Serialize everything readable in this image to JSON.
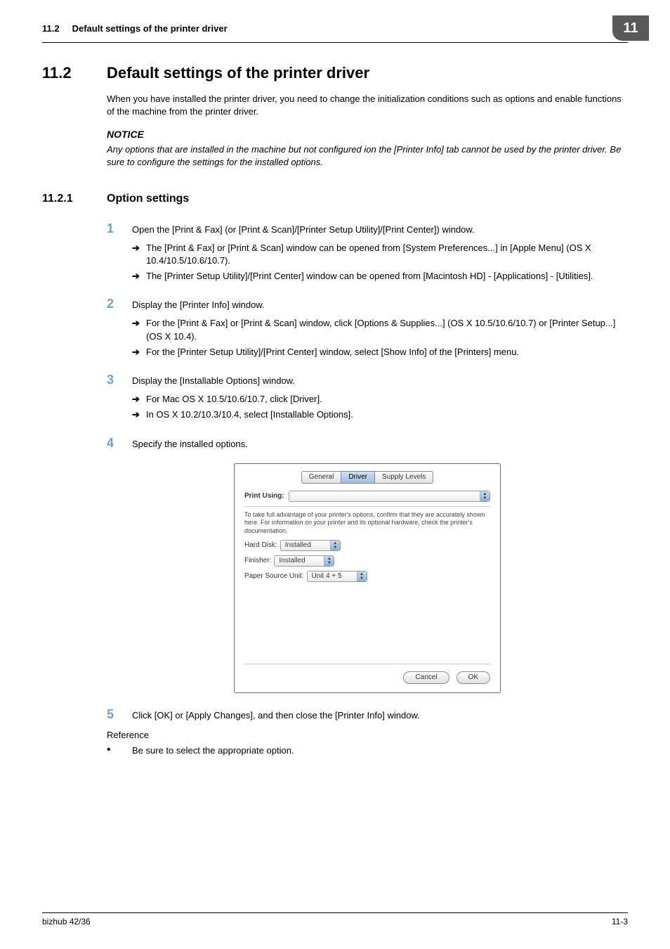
{
  "header": {
    "section_number": "11.2",
    "section_title": "Default settings of the printer driver",
    "chapter_badge": "11"
  },
  "section": {
    "number": "11.2",
    "title": "Default settings of the printer driver",
    "intro": "When you have installed the printer driver, you need to change the initialization conditions such as options and enable functions of the machine from the printer driver.",
    "notice_heading": "NOTICE",
    "notice_body": "Any options that are installed in the machine but not configured ion the [Printer Info] tab cannot be used by the printer driver. Be sure to configure the settings for the installed options."
  },
  "subsection": {
    "number": "11.2.1",
    "title": "Option settings"
  },
  "steps": [
    {
      "num": "1",
      "text": "Open the [Print & Fax] (or [Print & Scan]/[Printer Setup Utility]/[Print Center]) window.",
      "subs": [
        "The [Print & Fax] or [Print & Scan] window can be opened from [System Preferences...] in [Apple Menu] (OS X 10.4/10.5/10.6/10.7).",
        "The [Printer Setup Utility]/[Print Center] window can be opened from [Macintosh HD] - [Applications] - [Utilities]."
      ]
    },
    {
      "num": "2",
      "text": "Display the [Printer Info] window.",
      "subs": [
        "For the [Print & Fax] or [Print & Scan] window, click [Options & Supplies...] (OS X 10.5/10.6/10.7) or [Printer Setup...] (OS X 10.4).",
        "For the [Printer Setup Utility]/[Print Center] window, select [Show Info] of the [Printers] menu."
      ]
    },
    {
      "num": "3",
      "text": "Display the [Installable Options] window.",
      "subs": [
        "For Mac OS X 10.5/10.6/10.7, click [Driver].",
        "In OS X 10.2/10.3/10.4, select [Installable Options]."
      ]
    },
    {
      "num": "4",
      "text": "Specify the installed options.",
      "subs": []
    },
    {
      "num": "5",
      "text": "Click [OK] or [Apply Changes], and then close the [Printer Info] window.",
      "subs": []
    }
  ],
  "reference": {
    "heading": "Reference",
    "items": [
      "Be sure to select the appropriate option."
    ]
  },
  "dialog": {
    "tabs": [
      "General",
      "Driver",
      "Supply Levels"
    ],
    "active_tab": "Driver",
    "print_using_label": "Print Using:",
    "print_using_value": "",
    "info_text": "To take full advantage of your printer's options, confirm that they are accurately shown here. For information on your printer and its optional hardware, check the printer's documentation.",
    "options": [
      {
        "label": "Hard Disk:",
        "value": "Installed"
      },
      {
        "label": "Finisher:",
        "value": "Installed"
      },
      {
        "label": "Paper Source Unit:",
        "value": "Unit 4 + 5"
      }
    ],
    "buttons": {
      "cancel": "Cancel",
      "ok": "OK"
    }
  },
  "footer": {
    "left": "bizhub 42/36",
    "right": "11-3"
  }
}
